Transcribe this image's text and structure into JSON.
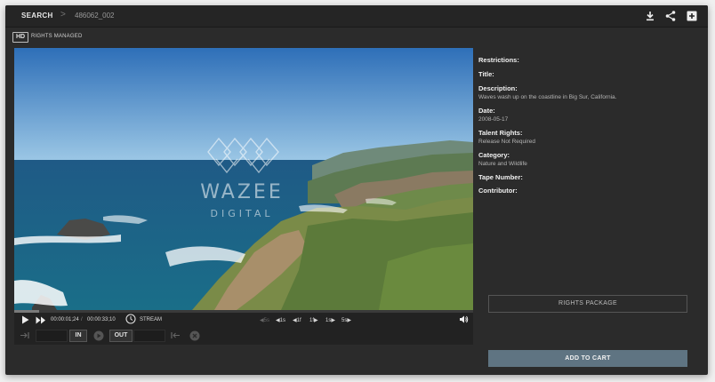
{
  "header": {
    "search_label": "SEARCH",
    "separator": ">",
    "clip_id": "486062_002",
    "icons": [
      "download-icon",
      "share-icon",
      "add-to-collection-icon"
    ]
  },
  "badge": {
    "hd": "HD",
    "license": "RIGHTS MANAGED"
  },
  "watermark": {
    "line1": "WAZEE",
    "line2": "DIGITAL"
  },
  "player": {
    "current_time": "00:00:01;24",
    "time_separator": "/",
    "duration": "00:00:33;10",
    "stream_label": "STREAM",
    "step_labels": [
      "5s",
      "1s",
      "1f",
      "1f",
      "1s",
      "5s"
    ],
    "in_label": "IN",
    "out_label": "OUT",
    "progress": 0.055
  },
  "metadata": [
    {
      "label": "Restrictions:",
      "value": ""
    },
    {
      "label": "Title:",
      "value": ""
    },
    {
      "label": "Description:",
      "value": "Waves wash up on the coastline in Big Sur, California."
    },
    {
      "label": "Date:",
      "value": "2008-05-17"
    },
    {
      "label": "Talent Rights:",
      "value": "Release Not Required"
    },
    {
      "label": "Category:",
      "value": "Nature and Wildlife"
    },
    {
      "label": "Tape Number:",
      "value": ""
    },
    {
      "label": "Contributor:",
      "value": ""
    }
  ],
  "actions": {
    "rights_package": "RIGHTS PACKAGE",
    "add_to_cart": "ADD TO CART"
  },
  "colors": {
    "background": "#2b2b2b",
    "topbar": "#252525",
    "cart_button": "#5f7482"
  }
}
